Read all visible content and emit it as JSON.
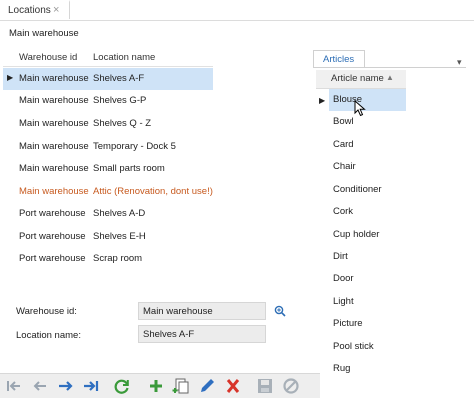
{
  "tab": {
    "label": "Locations",
    "close": "×"
  },
  "subtitle": "Main warehouse",
  "grid": {
    "headers": [
      "Warehouse id",
      "Location name"
    ],
    "rows": [
      {
        "warehouse": "Main warehouse",
        "location": "Shelves A-F",
        "selected": true
      },
      {
        "warehouse": "Main warehouse",
        "location": "Shelves G-P"
      },
      {
        "warehouse": "Main warehouse",
        "location": "Shelves Q - Z"
      },
      {
        "warehouse": "Main warehouse",
        "location": "Temporary - Dock 5"
      },
      {
        "warehouse": "Main warehouse",
        "location": "Small parts room"
      },
      {
        "warehouse": "Main warehouse",
        "location": "Attic (Renovation, dont use!)",
        "warning": true
      },
      {
        "warehouse": "Port warehouse",
        "location": "Shelves A-D"
      },
      {
        "warehouse": "Port warehouse",
        "location": "Shelves E-H"
      },
      {
        "warehouse": "Port warehouse",
        "location": "Scrap room"
      }
    ]
  },
  "form": {
    "warehouse_label": "Warehouse id:",
    "warehouse_value": "Main warehouse",
    "location_label": "Location name:",
    "location_value": "Shelves A-F"
  },
  "articles": {
    "tab_label": "Articles",
    "header": "Article name",
    "items": [
      "Blouse",
      "Bowl",
      "Card",
      "Chair",
      "Conditioner",
      "Cork",
      "Cup holder",
      "Dirt",
      "Door",
      "Light",
      "Picture",
      "Pool stick",
      "Rug"
    ],
    "selected_index": 0
  },
  "toolbar": {
    "buttons": [
      "first-icon",
      "prev-icon",
      "next-icon",
      "last-icon",
      "refresh-icon",
      "add-icon",
      "copy-icon",
      "edit-icon",
      "delete-icon",
      "save-icon",
      "cancel-icon"
    ]
  },
  "colors": {
    "accent": "#2c6db5",
    "selection": "#cfe3f7",
    "warning": "#c75a1f",
    "green": "#3a9a3a",
    "red": "#d8342a"
  }
}
